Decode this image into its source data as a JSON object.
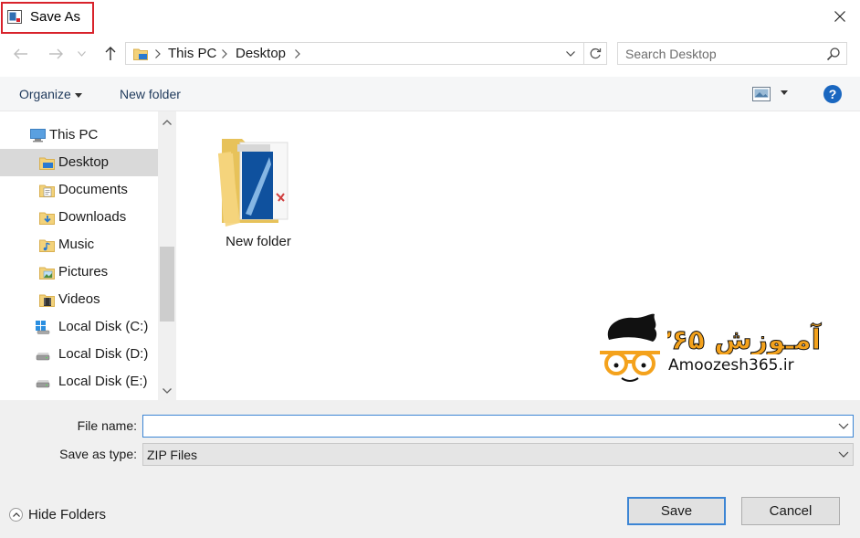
{
  "window": {
    "title": "Save As",
    "highlight_color": "#d8222b"
  },
  "address_bar": {
    "crumbs": [
      "This PC",
      "Desktop"
    ]
  },
  "search": {
    "placeholder": "Search Desktop"
  },
  "toolbar": {
    "organize_label": "Organize",
    "new_folder_label": "New folder",
    "help_label": "?"
  },
  "sidebar": {
    "items": [
      {
        "label": "This PC",
        "icon": "computer-icon"
      },
      {
        "label": "Desktop",
        "icon": "desktop-folder-icon",
        "selected": true
      },
      {
        "label": "Documents",
        "icon": "documents-folder-icon"
      },
      {
        "label": "Downloads",
        "icon": "downloads-folder-icon"
      },
      {
        "label": "Music",
        "icon": "music-folder-icon"
      },
      {
        "label": "Pictures",
        "icon": "pictures-folder-icon"
      },
      {
        "label": "Videos",
        "icon": "videos-folder-icon"
      },
      {
        "label": "Local Disk (C:)",
        "icon": "windows-drive-icon"
      },
      {
        "label": "Local Disk (D:)",
        "icon": "drive-icon"
      },
      {
        "label": "Local Disk (E:)",
        "icon": "drive-icon"
      }
    ]
  },
  "content": {
    "items": [
      {
        "label": "New folder",
        "icon": "folder-icon"
      }
    ]
  },
  "watermark": {
    "text": "Amoozesh365.ir",
    "logo_text": "آمـوزش ۳۶۵"
  },
  "form": {
    "file_name_label": "File name:",
    "file_name_value": "",
    "save_as_type_label": "Save as type:",
    "save_as_type_value": "ZIP Files"
  },
  "footer": {
    "hide_folders_label": "Hide Folders",
    "save_label": "Save",
    "cancel_label": "Cancel"
  },
  "colors": {
    "accent": "#3c85d4",
    "selection": "#d9d9d9",
    "toolbar_text": "#1e395b"
  }
}
